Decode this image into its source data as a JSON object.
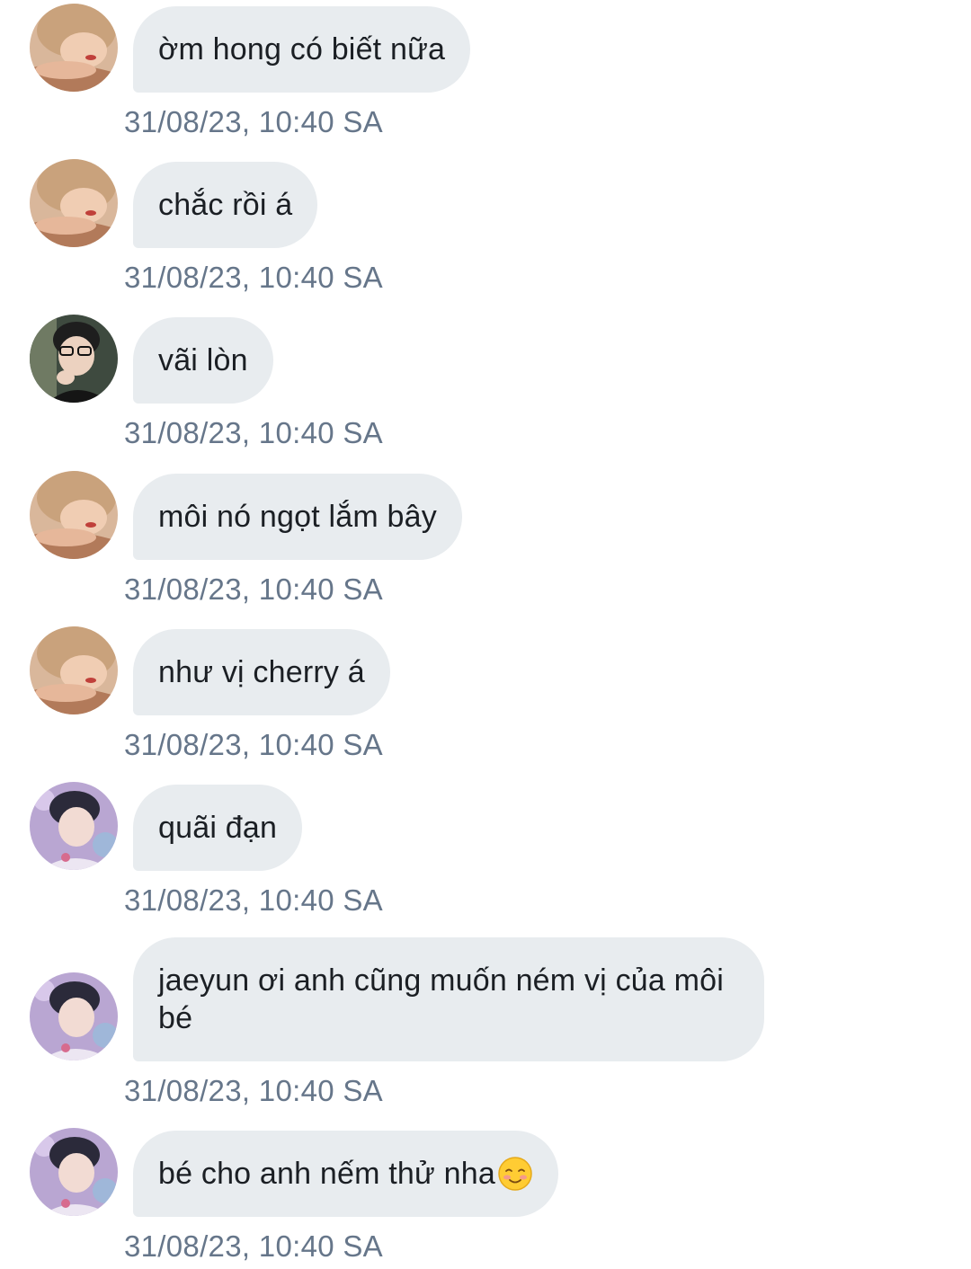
{
  "messages": [
    {
      "avatar": "avatar-a",
      "text": "ờm hong có biết nữa",
      "timestamp": "31/08/23, 10:40 SA"
    },
    {
      "avatar": "avatar-a",
      "text": "chắc rồi á",
      "timestamp": "31/08/23, 10:40 SA"
    },
    {
      "avatar": "avatar-b",
      "text": "vãi lòn",
      "timestamp": "31/08/23, 10:40 SA"
    },
    {
      "avatar": "avatar-a",
      "text": "môi nó ngọt lắm bây",
      "timestamp": "31/08/23, 10:40 SA"
    },
    {
      "avatar": "avatar-a",
      "text": "như vị cherry á",
      "timestamp": "31/08/23, 10:40 SA"
    },
    {
      "avatar": "avatar-c",
      "text": "quãi đạn",
      "timestamp": "31/08/23, 10:40 SA"
    },
    {
      "avatar": "avatar-c",
      "text": "jaeyun ơi anh cũng muốn ném vị của môi bé",
      "timestamp": "31/08/23, 10:40 SA"
    },
    {
      "avatar": "avatar-c",
      "text": "bé cho anh nếm thử nha",
      "emoji": "smiling-face-with-blush-emoji",
      "timestamp": "31/08/23, 10:40 SA"
    }
  ],
  "colors": {
    "bubble_background": "#e8ecef",
    "message_text": "#1b1f24",
    "timestamp_text": "#66768a",
    "page_background": "#ffffff"
  }
}
